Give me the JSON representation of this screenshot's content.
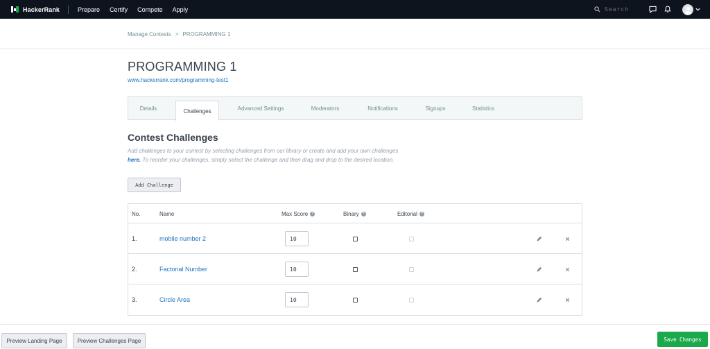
{
  "nav": {
    "brand": "HackerRank",
    "links": [
      "Prepare",
      "Certify",
      "Compete",
      "Apply"
    ],
    "search_placeholder": "Search"
  },
  "breadcrumb": {
    "parent": "Manage Contests",
    "separator": ">",
    "current": "PROGRAMMING 1"
  },
  "contest": {
    "title": "PROGRAMMING 1",
    "url": "www.hackerrank.com/programming-test1"
  },
  "tabs": [
    {
      "label": "Details",
      "active": false
    },
    {
      "label": "Challenges",
      "active": true
    },
    {
      "label": "Advanced Settings",
      "active": false
    },
    {
      "label": "Moderators",
      "active": false
    },
    {
      "label": "Notifications",
      "active": false
    },
    {
      "label": "Signups",
      "active": false
    },
    {
      "label": "Statistics",
      "active": false
    }
  ],
  "challenges_section": {
    "title": "Contest Challenges",
    "desc_part1": "Add challenges to your contest by selecting challenges from our library or create and add your own challenges ",
    "desc_link": "here.",
    "desc_part2": " To reorder your challenges, simply select the challenge and then drag and drop to the desired location.",
    "add_button": "Add Challenge"
  },
  "table": {
    "headers": {
      "no": "No.",
      "name": "Name",
      "max_score": "Max Score",
      "binary": "Binary",
      "editorial": "Editorial"
    },
    "rows": [
      {
        "no": "1.",
        "name": "mobile number 2",
        "score": "10"
      },
      {
        "no": "2.",
        "name": "Factorial Number",
        "score": "10"
      },
      {
        "no": "3.",
        "name": "Circle Area",
        "score": "10"
      }
    ]
  },
  "footer": {
    "preview_landing": "Preview Landing Page",
    "preview_challenges": "Preview Challenges Page",
    "save": "Save Changes"
  },
  "colors": {
    "nav_bg": "#0e141e",
    "link": "#1f74c0",
    "save_green": "#1ba94c"
  }
}
